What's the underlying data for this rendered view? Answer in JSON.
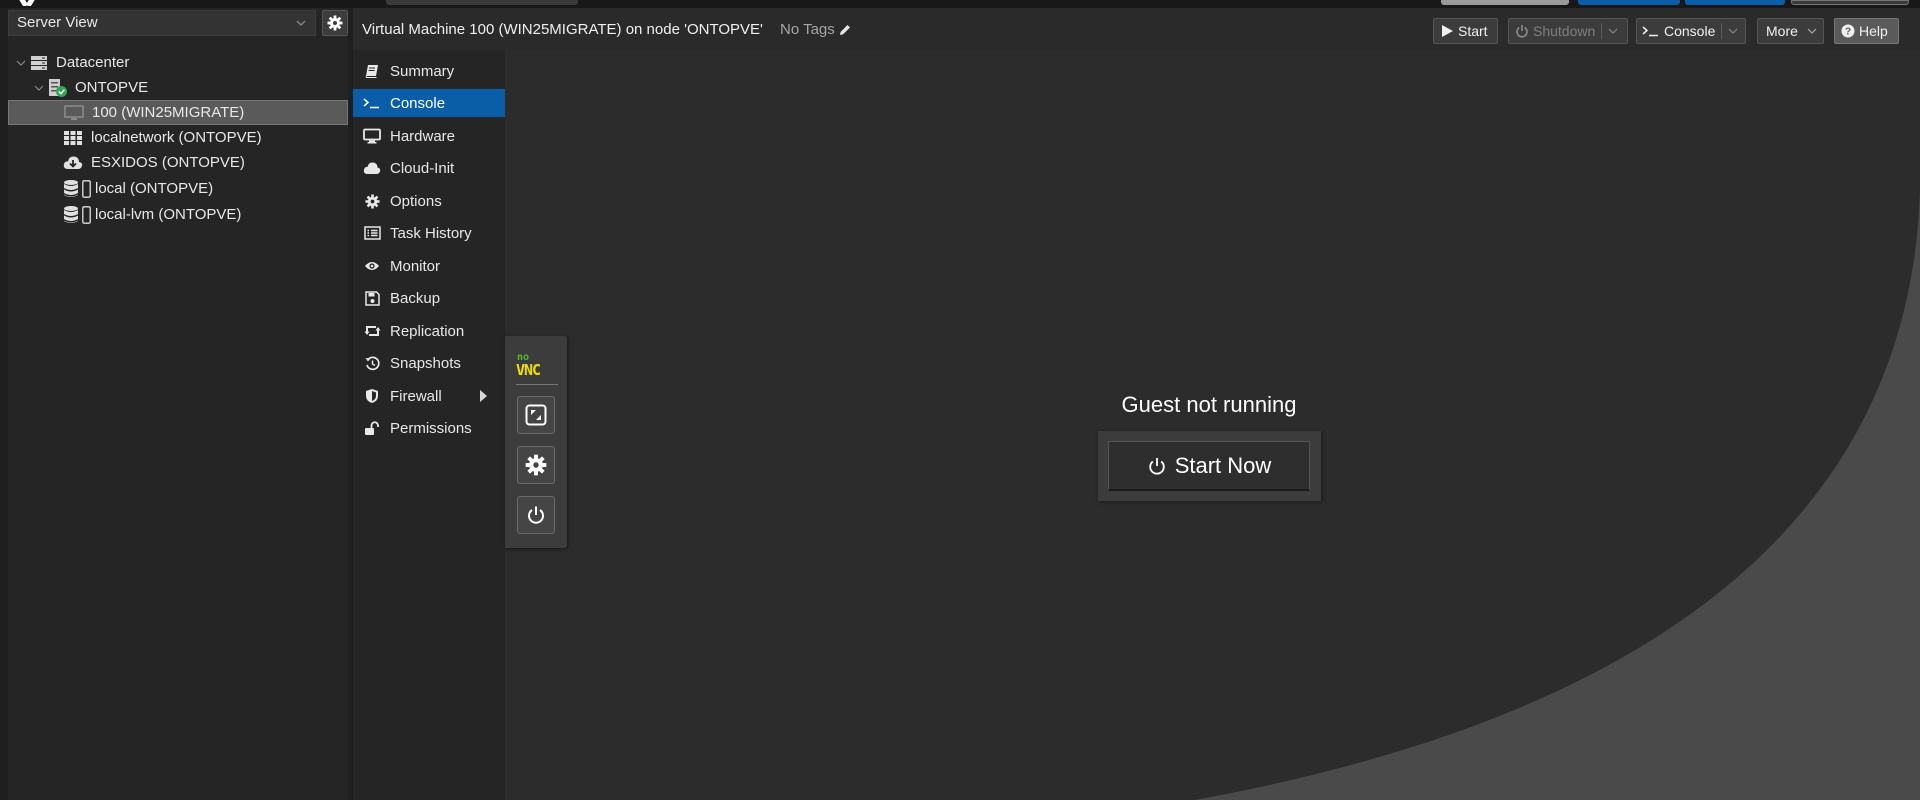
{
  "header": {
    "vm_title": "Virtual Machine 100 (WIN25MIGRATE) on node 'ONTOPVE'",
    "tags_label": "No Tags"
  },
  "toolbar": {
    "start_label": "Start",
    "shutdown_label": "Shutdown",
    "console_label": "Console",
    "more_label": "More",
    "help_label": "Help"
  },
  "sidebar": {
    "view_select": "Server View",
    "tree": [
      {
        "label": "Datacenter"
      },
      {
        "label": "ONTOPVE"
      },
      {
        "label": "100 (WIN25MIGRATE)"
      },
      {
        "label": "localnetwork (ONTOPVE)"
      },
      {
        "label": "ESXIDOS (ONTOPVE)"
      },
      {
        "label": "local (ONTOPVE)"
      },
      {
        "label": "local-lvm (ONTOPVE)"
      }
    ]
  },
  "vmnav": {
    "items": [
      {
        "label": "Summary",
        "icon": "book-icon"
      },
      {
        "label": "Console",
        "icon": "terminal-icon"
      },
      {
        "label": "Hardware",
        "icon": "desktop-icon"
      },
      {
        "label": "Cloud-Init",
        "icon": "cloud-icon"
      },
      {
        "label": "Options",
        "icon": "gear-icon"
      },
      {
        "label": "Task History",
        "icon": "list-icon"
      },
      {
        "label": "Monitor",
        "icon": "eye-icon"
      },
      {
        "label": "Backup",
        "icon": "floppy-icon"
      },
      {
        "label": "Replication",
        "icon": "retweet-icon"
      },
      {
        "label": "Snapshots",
        "icon": "history-icon"
      },
      {
        "label": "Firewall",
        "icon": "shield-icon"
      },
      {
        "label": "Permissions",
        "icon": "unlock-icon"
      }
    ]
  },
  "console": {
    "status_text": "Guest not running",
    "start_button": "Start Now",
    "vnc_logo_top": "no",
    "vnc_logo_bottom": "VNC"
  },
  "colors": {
    "accent": "#0a5ea8",
    "selected_tree": "#5a5a5a",
    "running_badge": "#2fa84f",
    "novnc_green": "#4fbe27",
    "novnc_yellow": "#f0e000"
  }
}
